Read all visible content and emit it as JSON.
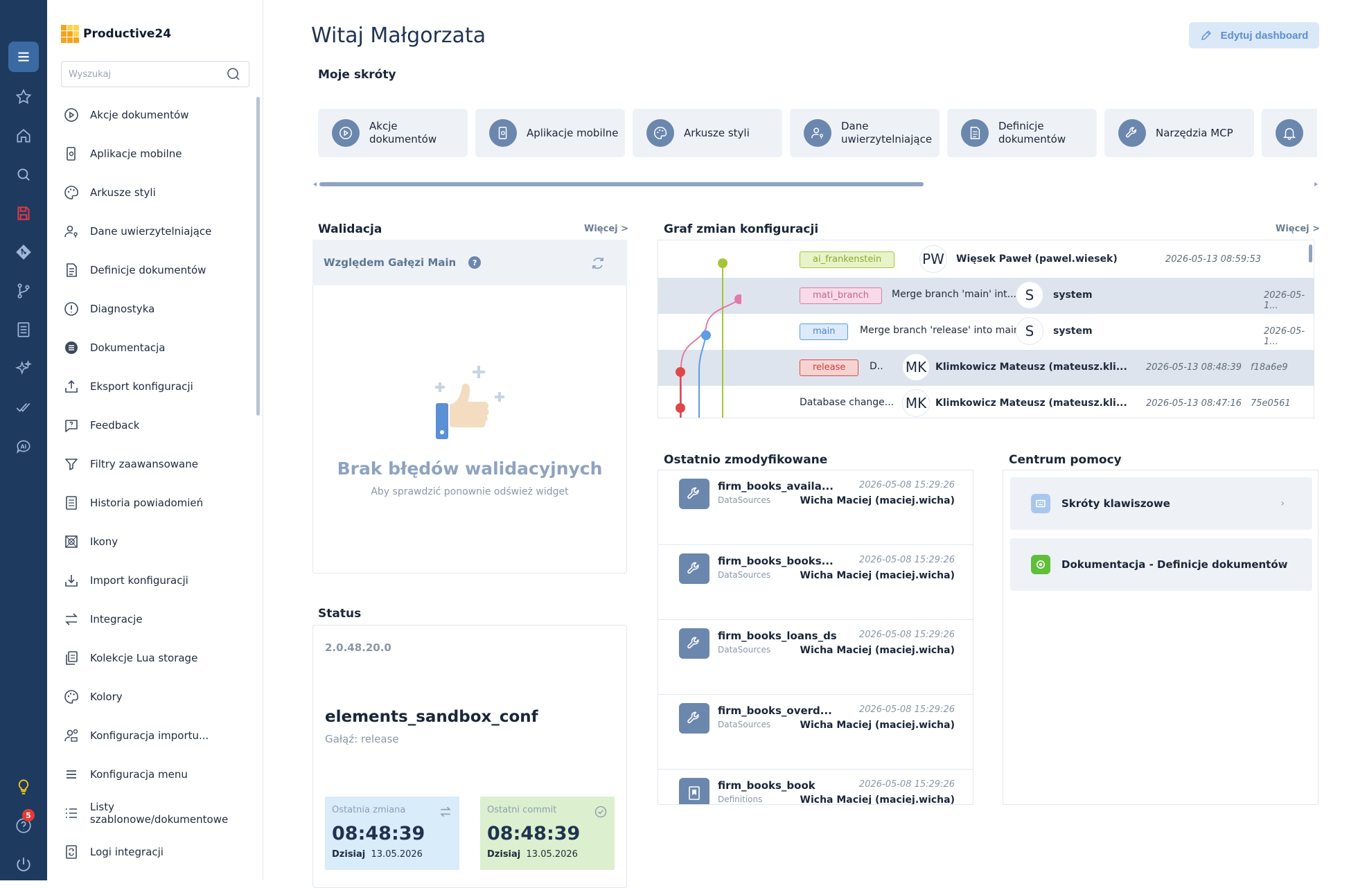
{
  "app": {
    "name": "Productive24"
  },
  "rail": {
    "notification_count": "5"
  },
  "search": {
    "placeholder": "Wyszukaj"
  },
  "sidebar": {
    "items": [
      {
        "label": "Akcje dokumentów",
        "icon": "play-circle-icon"
      },
      {
        "label": "Aplikacje mobilne",
        "icon": "mobile-app-icon"
      },
      {
        "label": "Arkusze styli",
        "icon": "palette-icon"
      },
      {
        "label": "Dane uwierzytelniające",
        "icon": "user-key-icon"
      },
      {
        "label": "Definicje dokumentów",
        "icon": "document-icon"
      },
      {
        "label": "Diagnostyka",
        "icon": "alert-circle-icon"
      },
      {
        "label": "Dokumentacja",
        "icon": "documentation-icon"
      },
      {
        "label": "Eksport konfiguracji",
        "icon": "upload-icon"
      },
      {
        "label": "Feedback",
        "icon": "feedback-icon"
      },
      {
        "label": "Filtry zaawansowane",
        "icon": "filter-icon"
      },
      {
        "label": "Historia powiadomień",
        "icon": "history-icon"
      },
      {
        "label": "Ikony",
        "icon": "icons-icon"
      },
      {
        "label": "Import konfiguracji",
        "icon": "download-icon"
      },
      {
        "label": "Integracje",
        "icon": "arrows-icon"
      },
      {
        "label": "Kolekcje Lua storage",
        "icon": "storage-icon"
      },
      {
        "label": "Kolory",
        "icon": "palette-icon"
      },
      {
        "label": "Konfiguracja importu...",
        "icon": "user-gear-icon"
      },
      {
        "label": "Konfiguracja menu",
        "icon": "menu-icon"
      },
      {
        "label": "Listy szablonowe/dokumentowe",
        "icon": "list-icon"
      },
      {
        "label": "Logi integracji",
        "icon": "log-icon"
      }
    ]
  },
  "header": {
    "greeting": "Witaj Małgorzata",
    "edit_label": "Edytuj dashboard"
  },
  "shortcuts": {
    "title": "Moje skróty",
    "items": [
      {
        "label": "Akcje dokumentów",
        "icon": "play-circle-icon"
      },
      {
        "label": "Aplikacje mobilne",
        "icon": "mobile-app-icon"
      },
      {
        "label": "Arkusze styli",
        "icon": "palette-icon"
      },
      {
        "label": "Dane uwierzytelniające",
        "icon": "user-key-icon"
      },
      {
        "label": "Definicje dokumentów",
        "icon": "document-icon"
      },
      {
        "label": "Narzędzia MCP",
        "icon": "wrench-icon"
      },
      {
        "label": "",
        "icon": "bell-icon"
      }
    ]
  },
  "validation": {
    "title": "Walidacja",
    "more": "Więcej >",
    "branch_label": "Względem Gałęzi Main",
    "empty_title": "Brak błędów walidacyjnych",
    "empty_sub": "Aby sprawdzić ponownie odśwież widget"
  },
  "graph": {
    "title": "Graf zmian konfiguracji",
    "more": "Więcej >",
    "rows": [
      {
        "tag": "ai_frankenstein",
        "message": "",
        "avatar": "PW",
        "author": "Więsek Paweł (pawel.wiesek)",
        "date": "2026-05-13 08:59:53",
        "hash": ""
      },
      {
        "tag": "mati_branch",
        "message": "Merge branch 'main' int...",
        "avatar": "S",
        "author": "system",
        "date": "2026-05-1...",
        "hash": ""
      },
      {
        "tag": "main",
        "message": "Merge branch 'release' into main",
        "avatar": "S",
        "author": "system",
        "date": "2026-05-1...",
        "hash": ""
      },
      {
        "tag": "release",
        "message": "D..",
        "avatar": "MK",
        "author": "Klimkowicz Mateusz (mateusz.kli...",
        "date": "2026-05-13 08:48:39",
        "hash": "f18a6e9"
      },
      {
        "tag": "",
        "message": "Database change...",
        "avatar": "MK",
        "author": "Klimkowicz Mateusz (mateusz.kli...",
        "date": "2026-05-13 08:47:16",
        "hash": "75e0561"
      }
    ]
  },
  "recent": {
    "title": "Ostatnio zmodyfikowane",
    "items": [
      {
        "name": "firm_books_availa...",
        "type": "DataSources",
        "date": "2026-05-08 15:29:26",
        "user": "Wicha Maciej (maciej.wicha)",
        "icon": "wrench-icon"
      },
      {
        "name": "firm_books_books...",
        "type": "DataSources",
        "date": "2026-05-08 15:29:26",
        "user": "Wicha Maciej (maciej.wicha)",
        "icon": "wrench-icon"
      },
      {
        "name": "firm_books_loans_ds",
        "type": "DataSources",
        "date": "2026-05-08 15:29:26",
        "user": "Wicha Maciej (maciej.wicha)",
        "icon": "wrench-icon"
      },
      {
        "name": "firm_books_overd...",
        "type": "DataSources",
        "date": "2026-05-08 15:29:26",
        "user": "Wicha Maciej (maciej.wicha)",
        "icon": "wrench-icon"
      },
      {
        "name": "firm_books_book",
        "type": "Definitions",
        "date": "2026-05-08 15:29:26",
        "user": "Wicha Maciej (maciej.wicha)",
        "icon": "definition-icon"
      }
    ]
  },
  "help": {
    "title": "Centrum pomocy",
    "items": [
      {
        "label": "Skróty klawiszowe",
        "icon": "keyboard-icon"
      },
      {
        "label": "Dokumentacja - Definicje dokumentów",
        "icon": "docs-icon"
      }
    ]
  },
  "status": {
    "title": "Status",
    "version": "2.0.48.20.0",
    "config_name": "elements_sandbox_conf",
    "branch": "Gałąź: release",
    "last_change_label": "Ostatnia zmiana",
    "last_change_time": "08:48:39",
    "last_change_day": "Dzisiaj",
    "last_change_date": "13.05.2026",
    "last_commit_label": "Ostatni commit",
    "last_commit_time": "08:48:39",
    "last_commit_day": "Dzisiaj",
    "last_commit_date": "13.05.2026"
  },
  "colors": {
    "rail_bg": "#1e3a5f",
    "accent": "#5b8fd6",
    "tag_green": "#a3c636",
    "tag_pink": "#e07aa8",
    "tag_blue": "#5b9de6",
    "tag_red": "#e04848",
    "tile_blue": "#d8ecfa",
    "tile_green": "#dcefcf"
  }
}
